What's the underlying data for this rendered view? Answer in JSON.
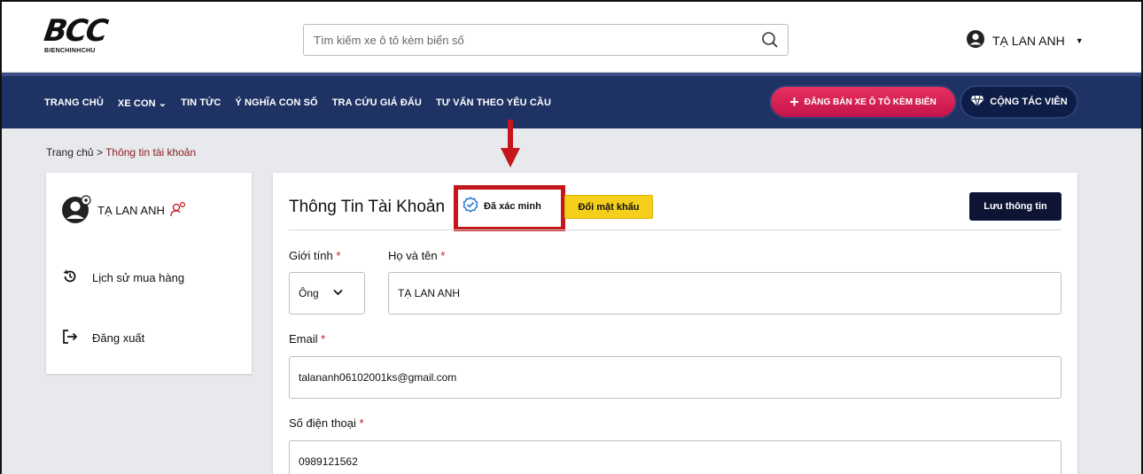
{
  "header": {
    "logo_main": "BCC",
    "logo_sub": "BIENCHINHCHU",
    "search_placeholder": "Tìm kiếm xe ô tô kèm biển số",
    "user_name": "TẠ LAN ANH"
  },
  "nav": {
    "items": [
      "TRANG CHỦ",
      "XE CON ⌄",
      "TIN TỨC",
      "Ý NGHĨA CON SỐ",
      "TRA CỨU GIÁ ĐẤU",
      "TƯ VẤN THEO YÊU CẦU"
    ],
    "sell_button": "ĐĂNG BÁN XE Ô TÔ KÈM BIỂN",
    "ctv_button": "CỘNG TÁC VIÊN"
  },
  "breadcrumb": {
    "home": "Trang chủ",
    "separator": ">",
    "current": "Thông tin tài khoản"
  },
  "sidebar": {
    "user_name": "TẠ LAN ANH",
    "items": [
      {
        "label": "Lịch sử mua hàng",
        "icon": "history-icon"
      },
      {
        "label": "Đăng xuất",
        "icon": "logout-icon"
      }
    ]
  },
  "account": {
    "title": "Thông Tin Tài Khoản",
    "verified": "Đã xác minh",
    "change_password": "Đổi mật khẩu",
    "save": "Lưu thông tin",
    "gender_label": "Giới tính",
    "gender_value": "Ông",
    "name_label": "Họ và tên",
    "name_value": "TẠ LAN ANH",
    "email_label": "Email",
    "email_value": "talananh06102001ks@gmail.com",
    "phone_label": "Số điện thoại",
    "phone_value": "0989121562",
    "required_mark": "*"
  },
  "colors": {
    "nav_bg": "#1f3264",
    "sell_button": "#d91f52",
    "highlight": "#c4161c",
    "password_button": "#f6cf1d",
    "save_button": "#0e1433"
  }
}
